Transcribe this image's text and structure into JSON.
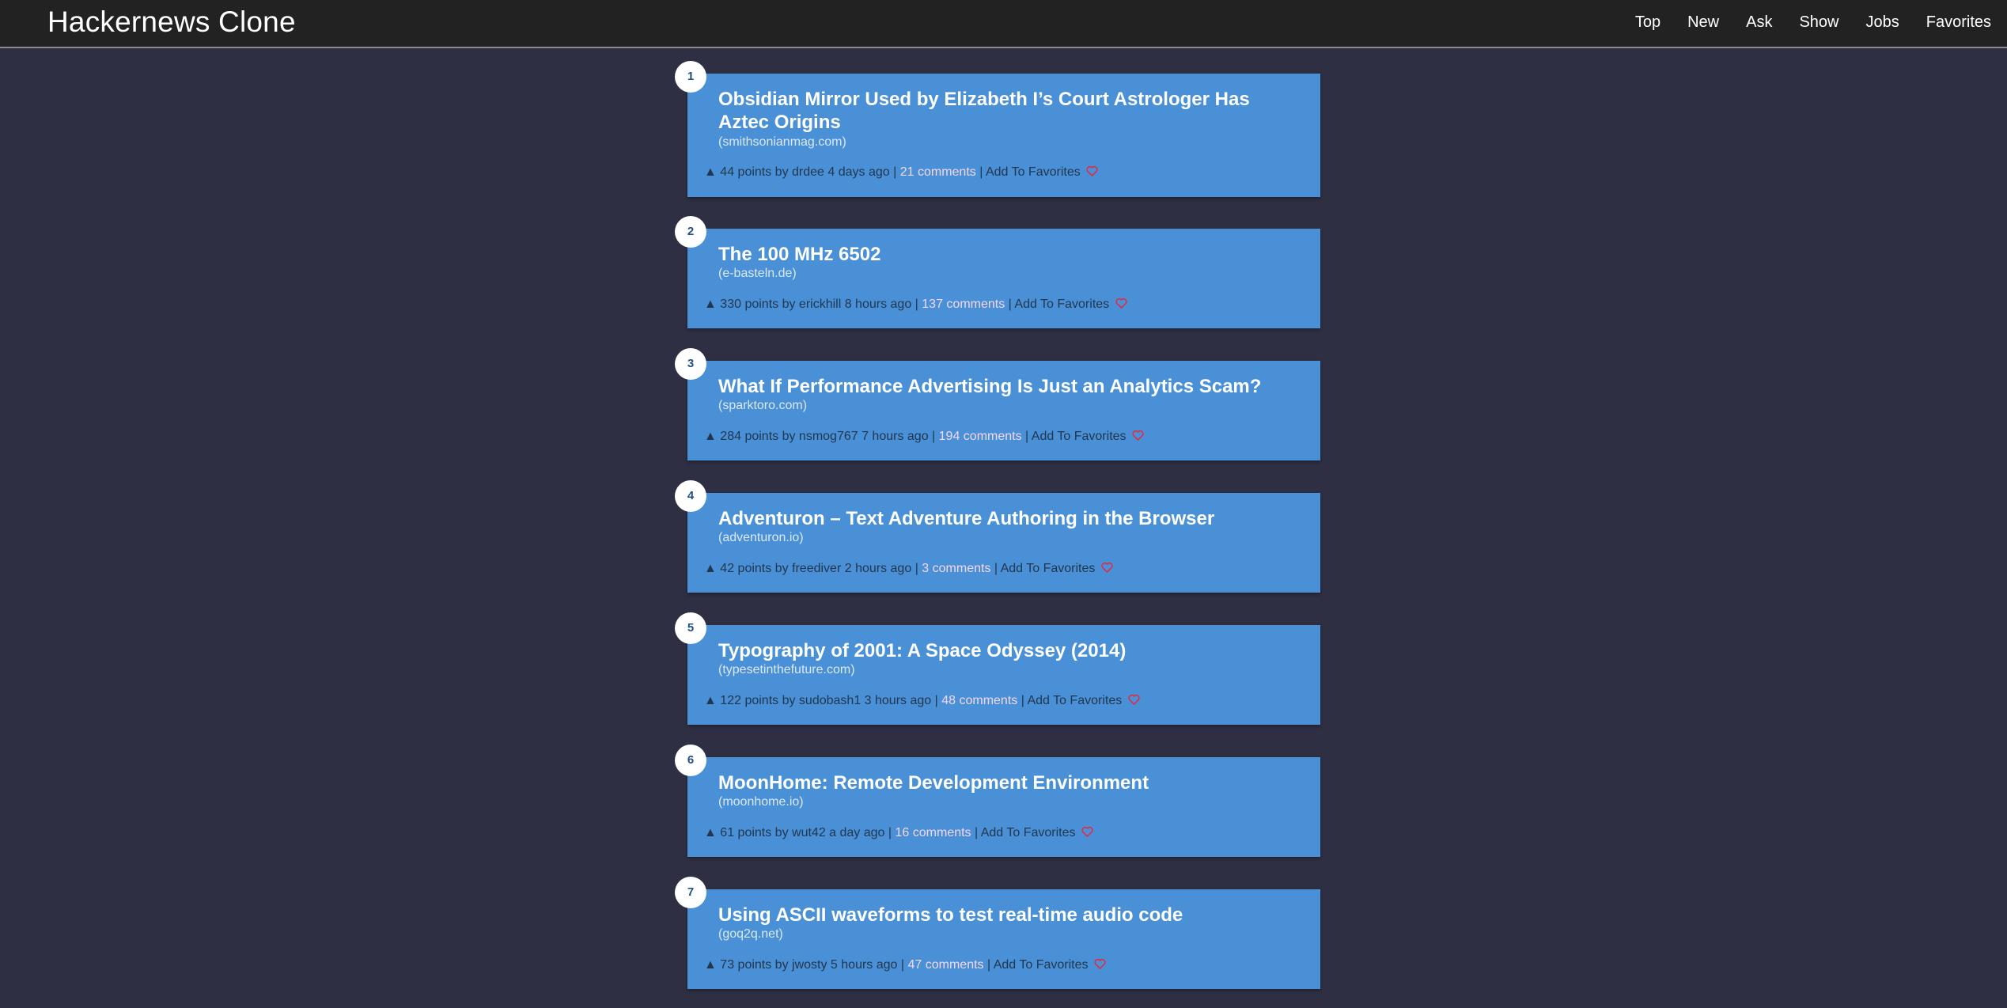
{
  "header": {
    "brand": "Hackernews Clone",
    "nav": [
      "Top",
      "New",
      "Ask",
      "Show",
      "Jobs",
      "Favorites"
    ]
  },
  "labels": {
    "add_to_favorites": "Add To Favorites",
    "upvote_glyph": "▲",
    "separator": "|"
  },
  "colors": {
    "background": "#2f2f43",
    "topbar": "#222222",
    "card": "#4a90d6",
    "comments_link": "#f5d7ee",
    "heart": "#e8263e"
  },
  "stories": [
    {
      "rank": "1",
      "title": "Obsidian Mirror Used by Elizabeth I’s Court Astrologer Has Aztec Origins",
      "domain": "(smithsonianmag.com)",
      "info": "44 points by drdee 4 days ago",
      "comments": "21 comments"
    },
    {
      "rank": "2",
      "title": "The 100 MHz 6502",
      "domain": "(e-basteln.de)",
      "info": "330 points by erickhill 8 hours ago",
      "comments": "137 comments"
    },
    {
      "rank": "3",
      "title": "What If Performance Advertising Is Just an Analytics Scam?",
      "domain": "(sparktoro.com)",
      "info": "284 points by nsmog767 7 hours ago",
      "comments": "194 comments"
    },
    {
      "rank": "4",
      "title": "Adventuron – Text Adventure Authoring in the Browser",
      "domain": "(adventuron.io)",
      "info": "42 points by freediver 2 hours ago",
      "comments": "3 comments"
    },
    {
      "rank": "5",
      "title": "Typography of 2001: A Space Odyssey (2014)",
      "domain": "(typesetinthefuture.com)",
      "info": "122 points by sudobash1 3 hours ago",
      "comments": "48 comments"
    },
    {
      "rank": "6",
      "title": "MoonHome: Remote Development Environment",
      "domain": "(moonhome.io)",
      "info": "61 points by wut42 a day ago",
      "comments": "16 comments"
    },
    {
      "rank": "7",
      "title": "Using ASCII waveforms to test real-time audio code",
      "domain": "(goq2q.net)",
      "info": "73 points by jwosty 5 hours ago",
      "comments": "47 comments"
    }
  ]
}
